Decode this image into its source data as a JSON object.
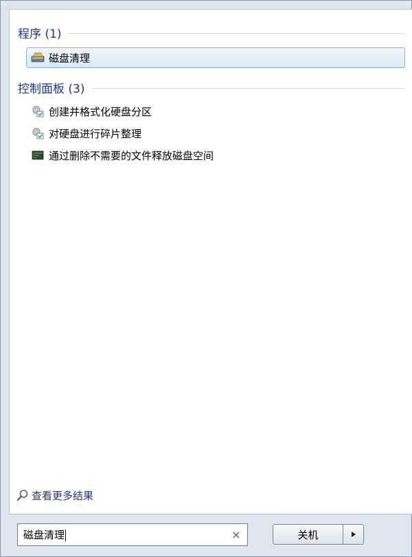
{
  "programs": {
    "title": "程序 (1)",
    "items": [
      {
        "label": "磁盘清理",
        "icon": "disk-cleanup-icon",
        "selected": true
      }
    ]
  },
  "control_panel": {
    "title": "控制面板 (3)",
    "items": [
      {
        "label": "创建并格式化硬盘分区",
        "icon": "admin-tools-icon"
      },
      {
        "label": "对硬盘进行碎片整理",
        "icon": "admin-tools-icon"
      },
      {
        "label": "通过删除不需要的文件释放磁盘空间",
        "icon": "disk-space-icon"
      }
    ]
  },
  "see_more": {
    "label": "查看更多结果",
    "icon": "search-icon"
  },
  "search": {
    "value": "磁盘清理",
    "clear_icon": "×"
  },
  "shutdown": {
    "label": "关机",
    "arrow_icon": "triangle-right-icon"
  },
  "colors": {
    "header_text": "#1e3287",
    "selection_border": "#84acdd",
    "selection_fill": "#dbeaf9"
  }
}
